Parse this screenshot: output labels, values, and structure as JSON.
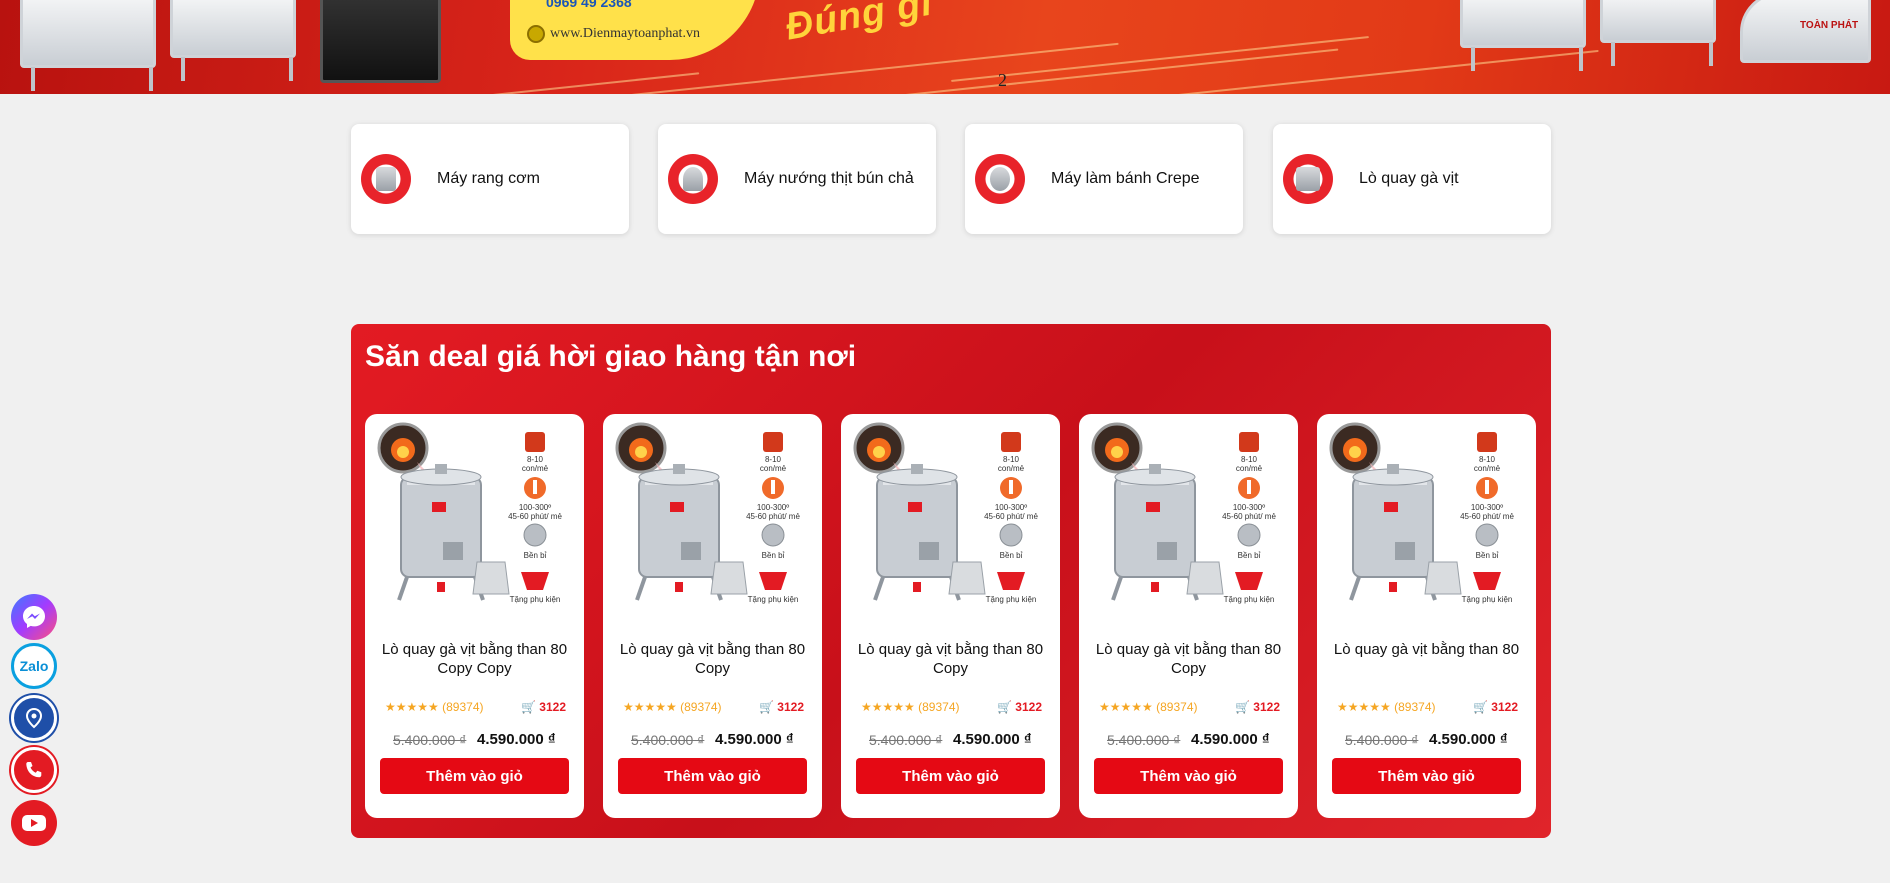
{
  "banner": {
    "phone": "0969 49 2368",
    "website": "www.Dienmaytoanphat.vn",
    "slogan": "Đúng gi",
    "slide_indicator": "2",
    "brand_tag": "TOÀN PHÁT"
  },
  "categories": [
    {
      "label": "Máy rang cơm",
      "icon": "rice-roaster-thumb"
    },
    {
      "label": "Máy nướng thịt bún chả",
      "icon": "grill-thumb"
    },
    {
      "label": "Máy làm bánh Crepe",
      "icon": "crepe-maker-thumb"
    },
    {
      "label": "Lò quay gà vịt",
      "icon": "duck-roaster-thumb"
    }
  ],
  "deal_section": {
    "title": "Săn deal giá hời giao hàng tận nơi",
    "products": [
      {
        "name": "Lò quay gà vịt bằng than 80 Copy Copy",
        "stars": "★★★★★",
        "reviews": "(89374)",
        "sold": "3122",
        "old_price": "5.400.000 ₫",
        "new_price": "4.590.000 ₫",
        "button": "Thêm vào giỏ"
      },
      {
        "name": "Lò quay gà vịt bằng than 80 Copy",
        "stars": "★★★★★",
        "reviews": "(89374)",
        "sold": "3122",
        "old_price": "5.400.000 ₫",
        "new_price": "4.590.000 ₫",
        "button": "Thêm vào giỏ"
      },
      {
        "name": "Lò quay gà vịt bằng than 80 Copy",
        "stars": "★★★★★",
        "reviews": "(89374)",
        "sold": "3122",
        "old_price": "5.400.000 ₫",
        "new_price": "4.590.000 ₫",
        "button": "Thêm vào giỏ"
      },
      {
        "name": "Lò quay gà vịt bằng than 80 Copy",
        "stars": "★★★★★",
        "reviews": "(89374)",
        "sold": "3122",
        "old_price": "5.400.000 ₫",
        "new_price": "4.590.000 ₫",
        "button": "Thêm vào giỏ"
      },
      {
        "name": "Lò quay gà vịt bằng than 80",
        "stars": "★★★★★",
        "reviews": "(89374)",
        "sold": "3122",
        "old_price": "5.400.000 ₫",
        "new_price": "4.590.000 ₫",
        "button": "Thêm vào giỏ"
      }
    ],
    "product_image_labels": {
      "capacity": "8-10",
      "capacity_unit": "con/mẻ",
      "temp": "100-300º",
      "time": "45-60 phút/ mẻ",
      "durable": "Bền bỉ",
      "gift": "Tặng phụ kiện"
    }
  },
  "floating_bar": {
    "zalo_label": "Zalo",
    "icons": [
      "messenger-icon",
      "zalo-icon",
      "map-pin-icon",
      "phone-icon",
      "youtube-icon"
    ]
  },
  "colors": {
    "brand_red": "#e31b23",
    "button_red": "#e50914",
    "star_orange": "#f5a623",
    "page_bg": "#f0f0f0"
  }
}
